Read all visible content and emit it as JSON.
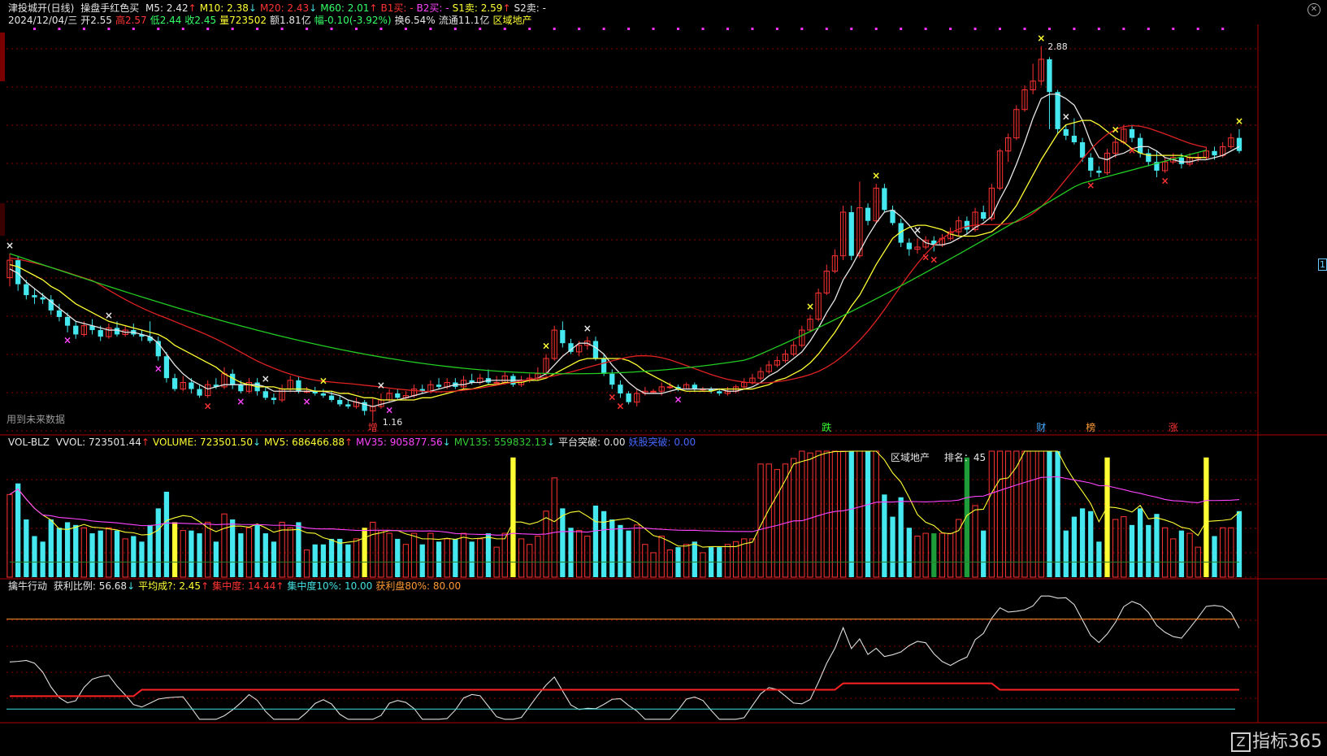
{
  "panel1": {
    "title": "津投城开(日线)",
    "indicator": "操盘手红色买",
    "ma": [
      {
        "label": "M5: 2.42",
        "arrow": "↑",
        "color": "#e6e6e6"
      },
      {
        "label": "M10: 2.38",
        "arrow": "↓",
        "color": "#ffff33"
      },
      {
        "label": "M20: 2.43",
        "arrow": "↓",
        "color": "#ff3333"
      },
      {
        "label": "M60: 2.01",
        "arrow": "↑",
        "color": "#33ff66"
      },
      {
        "label": "B1买: -",
        "arrow": "",
        "color": "#ff3333"
      },
      {
        "label": "B2买: -",
        "arrow": "",
        "color": "#ff44ff"
      },
      {
        "label": "S1卖: 2.59",
        "arrow": "↑",
        "color": "#ffff33"
      },
      {
        "label": "S2卖: -",
        "arrow": "",
        "color": "#e6e6e6"
      }
    ],
    "info": {
      "date": "2024/12/04/三",
      "open": "开2.55",
      "high": "高2.57",
      "low": "低2.44",
      "close": "收2.45",
      "vol": "量723502",
      "amount": "额1.81亿",
      "change": "幅-0.10(-3.92%)",
      "turnover": "换6.54%",
      "float": "流通11.1亿",
      "sector": "区域地产"
    },
    "future_note": "用到未来数据",
    "max_label": "2.88",
    "min_label": "1.16",
    "event_labels": [
      "增",
      "跌",
      "财",
      "榜",
      "涨"
    ]
  },
  "panel2": {
    "name": "VOL-BLZ",
    "items": [
      {
        "label": "VVOL: 723501.44",
        "arrow": "↑",
        "color": "#e6e6e6"
      },
      {
        "label": "VOLUME: 723501.50",
        "arrow": "↓",
        "color": "#ffff33"
      },
      {
        "label": "MV5: 686466.88",
        "arrow": "↑",
        "color": "#ffff33"
      },
      {
        "label": "MV35: 905877.56",
        "arrow": "↓",
        "color": "#ff44ff"
      },
      {
        "label": "MV135: 559832.13",
        "arrow": "↓",
        "color": "#33cc33"
      },
      {
        "label": "平台突破: 0.00",
        "arrow": "",
        "color": "#e6e6e6"
      },
      {
        "label": "妖股突破: 0.00",
        "arrow": "",
        "color": "#4466ff"
      }
    ],
    "sector_label": "区域地产",
    "rank_label": "排名：45"
  },
  "panel3": {
    "name": "擒牛行动",
    "items": [
      {
        "label": "获利比例: 56.68",
        "arrow": "↓",
        "color": "#e6e6e6"
      },
      {
        "label": "平均成?: 2.45",
        "arrow": "↑",
        "color": "#ffff33"
      },
      {
        "label": "集中度: 14.44",
        "arrow": "↑",
        "color": "#ff3333"
      },
      {
        "label": "集中度10%: 10.00",
        "arrow": "",
        "color": "#44e0e0"
      },
      {
        "label": "获利盘80%: 80.00",
        "arrow": "",
        "color": "#ff9933"
      }
    ]
  },
  "logo": {
    "mark": "Z",
    "text": "指标365"
  },
  "right_marker": "1",
  "colors": {
    "up": "#ff3333",
    "down": "#44e8ee",
    "ma5": "#e6e6e6",
    "ma10": "#ffff33",
    "ma20": "#dd2222",
    "ma60": "#22cc22",
    "grid": "#8b0000"
  },
  "chart_data": {
    "type": "candlestick",
    "ylim": [
      1.1,
      2.95
    ],
    "candles": [
      [
        1.82,
        1.9,
        1.93,
        1.78
      ],
      [
        1.9,
        1.79,
        1.92,
        1.76
      ],
      [
        1.79,
        1.74,
        1.81,
        1.72
      ],
      [
        1.74,
        1.73,
        1.77,
        1.7
      ],
      [
        1.73,
        1.72,
        1.75,
        1.7
      ],
      [
        1.72,
        1.67,
        1.74,
        1.65
      ],
      [
        1.67,
        1.64,
        1.7,
        1.62
      ],
      [
        1.64,
        1.6,
        1.66,
        1.57
      ],
      [
        1.6,
        1.56,
        1.62,
        1.54
      ],
      [
        1.56,
        1.6,
        1.62,
        1.55
      ],
      [
        1.6,
        1.58,
        1.63,
        1.56
      ],
      [
        1.58,
        1.55,
        1.6,
        1.53
      ],
      [
        1.55,
        1.59,
        1.61,
        1.54
      ],
      [
        1.59,
        1.56,
        1.62,
        1.55
      ],
      [
        1.56,
        1.58,
        1.6,
        1.55
      ],
      [
        1.58,
        1.56,
        1.61,
        1.55
      ],
      [
        1.56,
        1.55,
        1.58,
        1.53
      ],
      [
        1.55,
        1.53,
        1.62,
        1.52
      ],
      [
        1.53,
        1.46,
        1.55,
        1.44
      ],
      [
        1.46,
        1.36,
        1.48,
        1.34
      ],
      [
        1.36,
        1.31,
        1.38,
        1.3
      ],
      [
        1.31,
        1.34,
        1.37,
        1.3
      ],
      [
        1.34,
        1.31,
        1.36,
        1.29
      ],
      [
        1.31,
        1.28,
        1.33,
        1.27
      ],
      [
        1.28,
        1.33,
        1.35,
        1.27
      ],
      [
        1.33,
        1.32,
        1.36,
        1.31
      ],
      [
        1.32,
        1.38,
        1.41,
        1.31
      ],
      [
        1.38,
        1.33,
        1.4,
        1.31
      ],
      [
        1.33,
        1.3,
        1.35,
        1.29
      ],
      [
        1.3,
        1.34,
        1.36,
        1.29
      ],
      [
        1.34,
        1.3,
        1.36,
        1.28
      ],
      [
        1.3,
        1.27,
        1.32,
        1.26
      ],
      [
        1.27,
        1.26,
        1.29,
        1.24
      ],
      [
        1.26,
        1.31,
        1.33,
        1.25
      ],
      [
        1.31,
        1.35,
        1.37,
        1.3
      ],
      [
        1.35,
        1.3,
        1.37,
        1.29
      ],
      [
        1.3,
        1.3,
        1.32,
        1.29
      ],
      [
        1.3,
        1.29,
        1.32,
        1.28
      ],
      [
        1.29,
        1.28,
        1.31,
        1.27
      ],
      [
        1.28,
        1.26,
        1.3,
        1.25
      ],
      [
        1.26,
        1.24,
        1.28,
        1.23
      ],
      [
        1.24,
        1.23,
        1.26,
        1.22
      ],
      [
        1.23,
        1.25,
        1.27,
        1.22
      ],
      [
        1.25,
        1.21,
        1.26,
        1.19
      ],
      [
        1.21,
        1.23,
        1.27,
        1.16
      ],
      [
        1.23,
        1.26,
        1.29,
        1.22
      ],
      [
        1.26,
        1.29,
        1.31,
        1.25
      ],
      [
        1.29,
        1.27,
        1.31,
        1.26
      ],
      [
        1.27,
        1.28,
        1.3,
        1.26
      ],
      [
        1.28,
        1.31,
        1.33,
        1.27
      ],
      [
        1.31,
        1.3,
        1.33,
        1.29
      ],
      [
        1.3,
        1.33,
        1.35,
        1.29
      ],
      [
        1.33,
        1.32,
        1.36,
        1.31
      ],
      [
        1.32,
        1.34,
        1.36,
        1.31
      ],
      [
        1.34,
        1.32,
        1.36,
        1.31
      ],
      [
        1.32,
        1.35,
        1.37,
        1.31
      ],
      [
        1.35,
        1.34,
        1.38,
        1.33
      ],
      [
        1.34,
        1.36,
        1.38,
        1.33
      ],
      [
        1.36,
        1.34,
        1.4,
        1.33
      ],
      [
        1.34,
        1.34,
        1.37,
        1.33
      ],
      [
        1.34,
        1.37,
        1.39,
        1.33
      ],
      [
        1.37,
        1.33,
        1.38,
        1.32
      ],
      [
        1.33,
        1.35,
        1.37,
        1.32
      ],
      [
        1.35,
        1.36,
        1.38,
        1.34
      ],
      [
        1.36,
        1.38,
        1.41,
        1.35
      ],
      [
        1.38,
        1.45,
        1.47,
        1.37
      ],
      [
        1.45,
        1.58,
        1.6,
        1.44
      ],
      [
        1.58,
        1.52,
        1.62,
        1.5
      ],
      [
        1.52,
        1.48,
        1.54,
        1.47
      ],
      [
        1.48,
        1.51,
        1.53,
        1.46
      ],
      [
        1.51,
        1.53,
        1.55,
        1.49
      ],
      [
        1.53,
        1.45,
        1.55,
        1.44
      ],
      [
        1.45,
        1.38,
        1.47,
        1.37
      ],
      [
        1.38,
        1.33,
        1.4,
        1.31
      ],
      [
        1.33,
        1.29,
        1.35,
        1.27
      ],
      [
        1.29,
        1.25,
        1.3,
        1.24
      ],
      [
        1.25,
        1.29,
        1.31,
        1.23
      ],
      [
        1.29,
        1.3,
        1.32,
        1.28
      ],
      [
        1.3,
        1.3,
        1.31,
        1.29
      ],
      [
        1.3,
        1.32,
        1.34,
        1.28
      ],
      [
        1.32,
        1.32,
        1.34,
        1.31
      ],
      [
        1.32,
        1.31,
        1.33,
        1.3
      ],
      [
        1.31,
        1.33,
        1.34,
        1.31
      ],
      [
        1.33,
        1.31,
        1.34,
        1.3
      ],
      [
        1.31,
        1.31,
        1.32,
        1.3
      ],
      [
        1.31,
        1.3,
        1.32,
        1.29
      ],
      [
        1.3,
        1.29,
        1.31,
        1.28
      ],
      [
        1.29,
        1.3,
        1.32,
        1.28
      ],
      [
        1.3,
        1.32,
        1.33,
        1.29
      ],
      [
        1.32,
        1.34,
        1.36,
        1.31
      ],
      [
        1.34,
        1.36,
        1.38,
        1.33
      ],
      [
        1.36,
        1.39,
        1.41,
        1.35
      ],
      [
        1.39,
        1.42,
        1.44,
        1.38
      ],
      [
        1.42,
        1.44,
        1.46,
        1.41
      ],
      [
        1.44,
        1.47,
        1.49,
        1.43
      ],
      [
        1.47,
        1.51,
        1.53,
        1.46
      ],
      [
        1.51,
        1.58,
        1.6,
        1.5
      ],
      [
        1.58,
        1.63,
        1.65,
        1.57
      ],
      [
        1.63,
        1.75,
        1.77,
        1.62
      ],
      [
        1.75,
        1.85,
        1.88,
        1.74
      ],
      [
        1.85,
        1.92,
        1.95,
        1.84
      ],
      [
        1.92,
        2.12,
        2.15,
        1.9
      ],
      [
        2.12,
        1.92,
        2.15,
        1.9
      ],
      [
        1.92,
        2.14,
        2.26,
        1.91
      ],
      [
        2.14,
        2.08,
        2.16,
        2.06
      ],
      [
        2.08,
        2.23,
        2.25,
        2.07
      ],
      [
        2.23,
        2.13,
        2.25,
        2.12
      ],
      [
        2.13,
        2.07,
        2.15,
        2.06
      ],
      [
        2.07,
        1.98,
        2.09,
        1.96
      ],
      [
        1.98,
        1.95,
        2.0,
        1.92
      ],
      [
        1.95,
        1.96,
        2.0,
        1.93
      ],
      [
        1.96,
        1.99,
        2.01,
        1.95
      ],
      [
        1.99,
        1.97,
        2.01,
        1.94
      ],
      [
        1.97,
        2.0,
        2.02,
        1.96
      ],
      [
        2.0,
        2.03,
        2.05,
        1.99
      ],
      [
        2.03,
        2.08,
        2.1,
        2.01
      ],
      [
        2.08,
        2.04,
        2.1,
        2.02
      ],
      [
        2.04,
        2.12,
        2.14,
        2.03
      ],
      [
        2.12,
        2.09,
        2.15,
        2.08
      ],
      [
        2.09,
        2.23,
        2.25,
        2.08
      ],
      [
        2.23,
        2.4,
        2.41,
        2.22
      ],
      [
        2.4,
        2.46,
        2.48,
        2.35
      ],
      [
        2.46,
        2.59,
        2.61,
        2.45
      ],
      [
        2.59,
        2.68,
        2.7,
        2.58
      ],
      [
        2.68,
        2.72,
        2.8,
        2.66
      ],
      [
        2.72,
        2.82,
        2.88,
        2.7
      ],
      [
        2.82,
        2.67,
        2.83,
        2.5
      ],
      [
        2.67,
        2.5,
        2.68,
        2.48
      ],
      [
        2.5,
        2.47,
        2.52,
        2.45
      ],
      [
        2.47,
        2.44,
        2.55,
        2.43
      ],
      [
        2.44,
        2.37,
        2.46,
        2.35
      ],
      [
        2.37,
        2.31,
        2.39,
        2.28
      ],
      [
        2.31,
        2.3,
        2.33,
        2.28
      ],
      [
        2.3,
        2.39,
        2.41,
        2.29
      ],
      [
        2.39,
        2.44,
        2.46,
        2.37
      ],
      [
        2.44,
        2.5,
        2.52,
        2.43
      ],
      [
        2.5,
        2.46,
        2.52,
        2.44
      ],
      [
        2.46,
        2.39,
        2.48,
        2.37
      ],
      [
        2.39,
        2.35,
        2.41,
        2.33
      ],
      [
        2.35,
        2.31,
        2.4,
        2.28
      ],
      [
        2.31,
        2.35,
        2.37,
        2.3
      ],
      [
        2.35,
        2.37,
        2.39,
        2.34
      ],
      [
        2.37,
        2.34,
        2.39,
        2.32
      ],
      [
        2.34,
        2.37,
        2.39,
        2.33
      ],
      [
        2.37,
        2.37,
        2.39,
        2.35
      ],
      [
        2.37,
        2.4,
        2.42,
        2.36
      ],
      [
        2.4,
        2.38,
        2.42,
        2.36
      ],
      [
        2.38,
        2.42,
        2.44,
        2.37
      ],
      [
        2.42,
        2.46,
        2.48,
        2.41
      ],
      [
        2.46,
        2.4,
        2.5,
        2.39
      ]
    ],
    "ma5": [
      1.86,
      1.84,
      1.8,
      1.77,
      1.74,
      1.71,
      1.68,
      1.65,
      1.62,
      1.61,
      1.6,
      1.59,
      1.58,
      1.58,
      1.57,
      1.57,
      1.56,
      1.55,
      1.52,
      1.47,
      1.42,
      1.38,
      1.35,
      1.33,
      1.31,
      1.32,
      1.33,
      1.33,
      1.33,
      1.33,
      1.33,
      1.32,
      1.3,
      1.3,
      1.3,
      1.3,
      1.3,
      1.3,
      1.3,
      1.29,
      1.28,
      1.26,
      1.25,
      1.24,
      1.23,
      1.24,
      1.25,
      1.26,
      1.27,
      1.28,
      1.29,
      1.3,
      1.31,
      1.32,
      1.33,
      1.33,
      1.34,
      1.34,
      1.35,
      1.35,
      1.35,
      1.35,
      1.35,
      1.35,
      1.36,
      1.38,
      1.42,
      1.46,
      1.49,
      1.52,
      1.52,
      1.5,
      1.47,
      1.42,
      1.38,
      1.34,
      1.31,
      1.29,
      1.29,
      1.29,
      1.3,
      1.31,
      1.31,
      1.31,
      1.31,
      1.31,
      1.31,
      1.3,
      1.3,
      1.31,
      1.32,
      1.34,
      1.37,
      1.39,
      1.42,
      1.45,
      1.48,
      1.53,
      1.59,
      1.66,
      1.72,
      1.81,
      1.87,
      1.94,
      2.01,
      2.07,
      2.12,
      2.13,
      2.1,
      2.06,
      2.01,
      1.98,
      1.97,
      1.97,
      1.98,
      2.0,
      2.02,
      2.05,
      2.07,
      2.1,
      2.18,
      2.25,
      2.34,
      2.44,
      2.55,
      2.64,
      2.66,
      2.66,
      2.64,
      2.61,
      2.54,
      2.44,
      2.37,
      2.36,
      2.38,
      2.39,
      2.41,
      2.42,
      2.42,
      2.4,
      2.37,
      2.36,
      2.35,
      2.35,
      2.36,
      2.36,
      2.37,
      2.38,
      2.4,
      2.42
    ],
    "ma10": [
      1.88,
      1.87,
      1.85,
      1.83,
      1.81,
      1.78,
      1.76,
      1.73,
      1.7,
      1.68,
      1.66,
      1.64,
      1.62,
      1.61,
      1.6,
      1.59,
      1.58,
      1.57,
      1.56,
      1.54,
      1.51,
      1.49,
      1.47,
      1.45,
      1.43,
      1.41,
      1.38,
      1.36,
      1.34,
      1.33,
      1.32,
      1.32,
      1.32,
      1.31,
      1.31,
      1.31,
      1.31,
      1.3,
      1.3,
      1.3,
      1.29,
      1.29,
      1.28,
      1.27,
      1.27,
      1.26,
      1.26,
      1.26,
      1.26,
      1.26,
      1.27,
      1.27,
      1.28,
      1.29,
      1.3,
      1.31,
      1.31,
      1.32,
      1.33,
      1.33,
      1.34,
      1.34,
      1.34,
      1.35,
      1.35,
      1.36,
      1.38,
      1.4,
      1.42,
      1.44,
      1.45,
      1.45,
      1.45,
      1.45,
      1.45,
      1.44,
      1.42,
      1.39,
      1.37,
      1.35,
      1.33,
      1.31,
      1.3,
      1.3,
      1.3,
      1.3,
      1.31,
      1.31,
      1.31,
      1.31,
      1.31,
      1.32,
      1.33,
      1.35,
      1.36,
      1.38,
      1.4,
      1.43,
      1.47,
      1.52,
      1.57,
      1.63,
      1.69,
      1.74,
      1.81,
      1.88,
      1.94,
      2.0,
      2.03,
      2.05,
      2.06,
      2.06,
      2.05,
      2.04,
      2.02,
      2.01,
      2.01,
      2.01,
      2.02,
      2.03,
      2.06,
      2.1,
      2.15,
      2.22,
      2.29,
      2.36,
      2.42,
      2.48,
      2.52,
      2.53,
      2.54,
      2.54,
      2.52,
      2.49,
      2.46,
      2.44,
      2.41,
      2.39,
      2.38,
      2.38,
      2.38,
      2.38,
      2.38,
      2.37,
      2.37,
      2.37
    ]
  }
}
